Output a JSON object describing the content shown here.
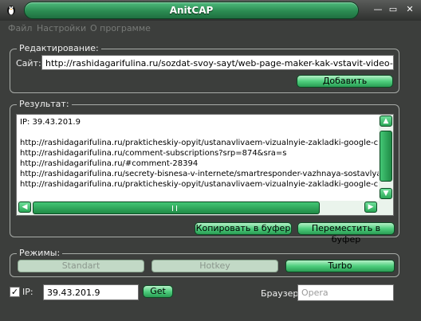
{
  "window": {
    "title": "AnitCAP",
    "min_glyph": "—",
    "restore_glyph": "▭",
    "close_glyph": "✕"
  },
  "menu": {
    "items": [
      "Файл",
      "Настройки",
      "О программе"
    ]
  },
  "editing": {
    "group_label": "Редактирование:",
    "site_label": "Сайт:",
    "site_value": "http://rashidagarifulina.ru/sozdat-svoy-sayt/web-page-maker-kak-vstavit-video-na-sayt.html/",
    "add_button": "Добавить"
  },
  "result": {
    "group_label": "Результат:",
    "lines": [
      "IP: 39.43.201.9",
      "",
      "http://rashidagarifulina.ru/prakticheskiy-opyit/ustanavlivaem-vizualnyie-zakladki-google-chrome.",
      "http://rashidagarifulina.ru/comment-subscriptions?srp=874&sra=s",
      "http://rashidagarifulina.ru/#comment-28394",
      "http://rashidagarifulina.ru/secrety-bisnesa-v-internete/smartresponder-vazhnaya-sostavlyayushh",
      "http://rashidagarifulina.ru/prakticheskiy-opyit/ustanavlivaem-vizualnyie-zakladki-google-chrome."
    ],
    "copy_button": "Копировать в буфер",
    "move_button": "Переместить в буфер",
    "up_arrow": "▲",
    "down_arrow": "▼",
    "left_arrow": "◀",
    "right_arrow": "▶"
  },
  "modes": {
    "group_label": "Режимы:",
    "standart": "Standart",
    "hotkey": "Hotkey",
    "turbo": "Turbo"
  },
  "bottom": {
    "ip_check": "✓",
    "ip_label": "IP:",
    "ip_value": "39.43.201.9",
    "get_button": "Get",
    "browser_label": "Браузер:",
    "browser_placeholder": "Opera"
  },
  "colors": {
    "accent_green": "#2aa857",
    "window_bg": "#3c3e3c"
  }
}
